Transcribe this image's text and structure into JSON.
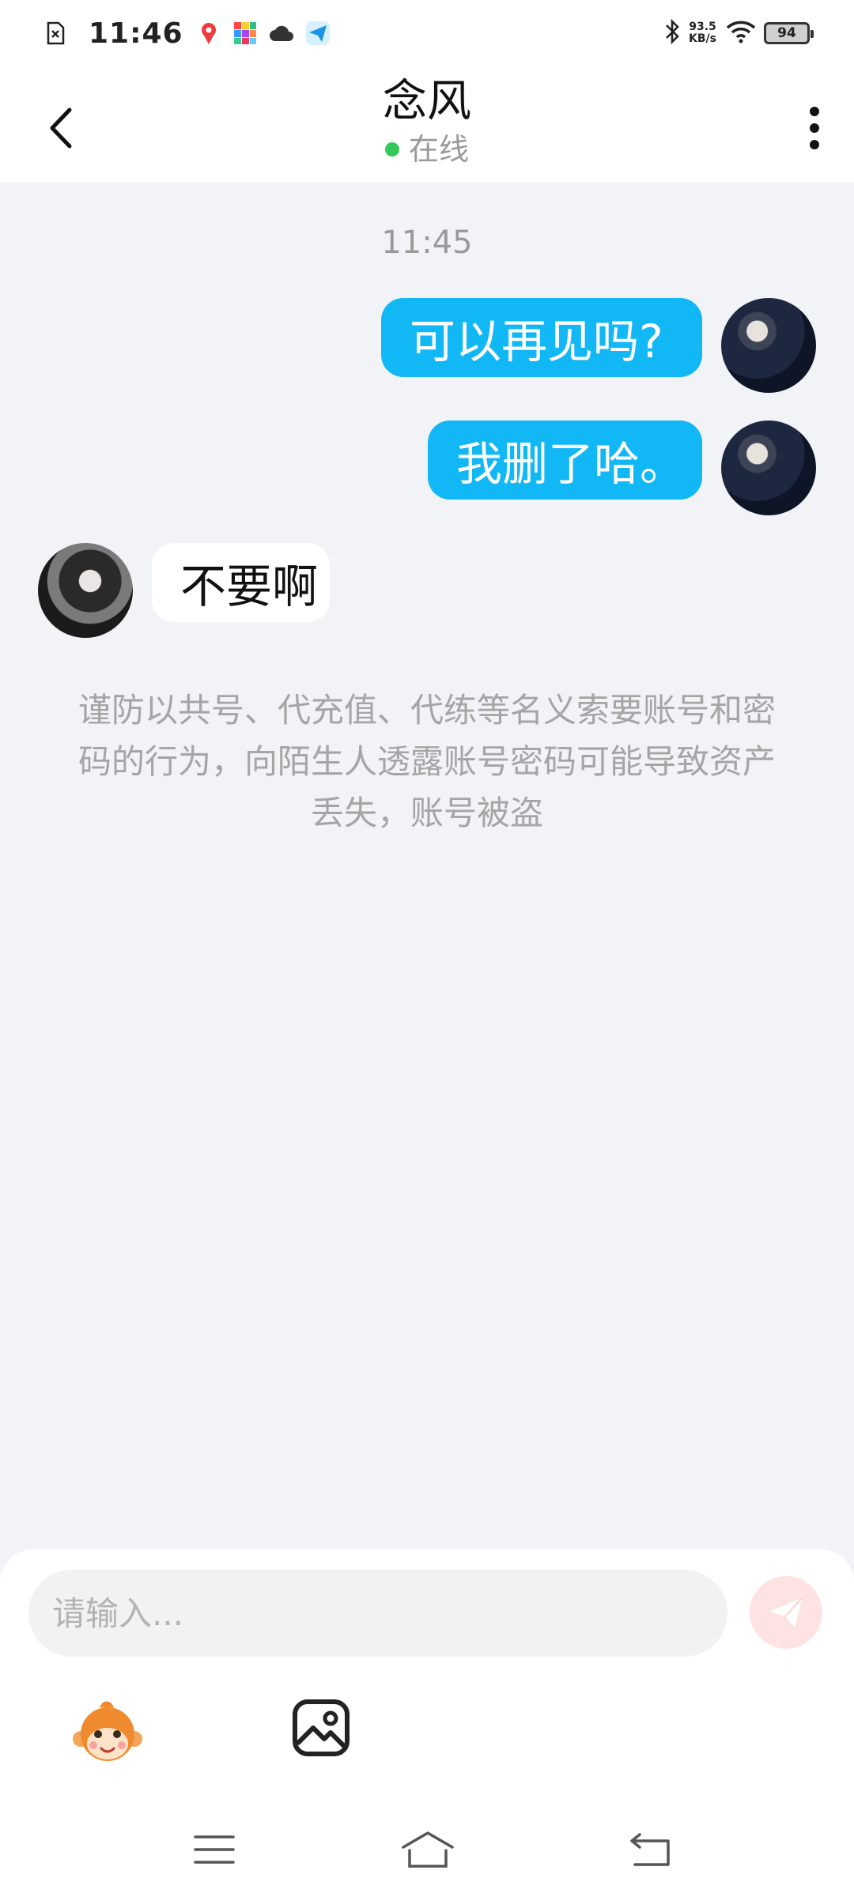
{
  "status_bar": {
    "time": "11:46",
    "net_speed_value": "93.5",
    "net_speed_unit": "KB/s",
    "battery": "94",
    "icons": [
      "sim-error-icon",
      "map-pin-app-icon",
      "colorful-app-icon",
      "cloud-icon",
      "paper-plane-app-icon",
      "bluetooth-icon",
      "wifi-icon",
      "battery-icon"
    ]
  },
  "header": {
    "title": "念风",
    "presence": "在线",
    "presence_color": "#34c759"
  },
  "chat": {
    "timestamp": "11:45",
    "messages": [
      {
        "sender": "me",
        "text": "可以再见吗?"
      },
      {
        "sender": "me",
        "text": "我删了哈。"
      },
      {
        "sender": "other",
        "text": "不要啊"
      }
    ],
    "notice": "谨防以共号、代充值、代练等名义索要账号和密码的行为，向陌生人透露账号密码可能导致资产丢失，账号被盗"
  },
  "composer": {
    "placeholder": "请输入...",
    "value": "",
    "send_icon": "paper-plane-icon",
    "tools": [
      "monkey-emoji-icon",
      "image-icon"
    ]
  },
  "nav": {
    "buttons": [
      "menu-icon",
      "home-icon",
      "back-icon"
    ]
  },
  "colors": {
    "my_bubble": "#12b7f5",
    "their_bubble": "#ffffff",
    "background": "#f1f3f7",
    "send_button_disabled": "#ffe2e2"
  }
}
